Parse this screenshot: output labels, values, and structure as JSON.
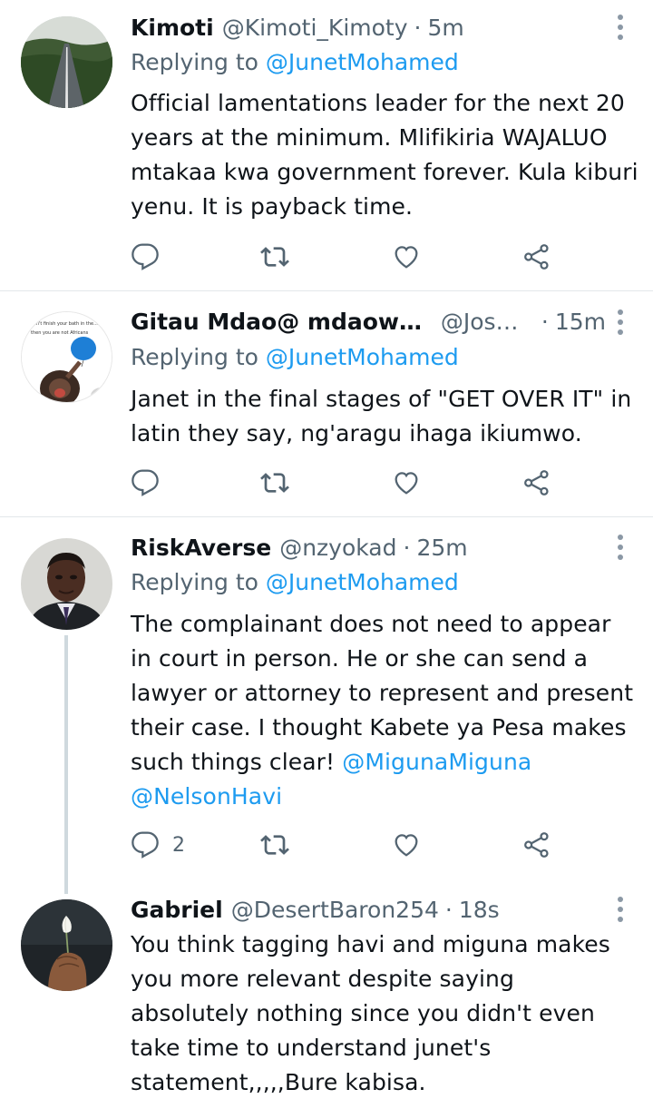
{
  "tweets": [
    {
      "name": "Kimoti",
      "handle": "@Kimoti_Kimoty",
      "sep": "·",
      "time": "5m",
      "replying_prefix": "Replying to ",
      "replying_to": "@JunetMohamed",
      "text": "Official lamentations leader for the next 20 years at the minimum. Mlifikiria WAJALUO mtakaa kwa government forever. Kula kiburi yenu. It is payback time.",
      "avatar": "road-landscape",
      "reply_count": ""
    },
    {
      "name": "Gitau Mdao@ mdaowetu",
      "handle": "@Jose...",
      "sep": "·",
      "time": "15m",
      "replying_prefix": "Replying to ",
      "replying_to": "@JunetMohamed",
      "text": "Janet in the final stages of \"GET OVER IT\" in latin they say, ng'aragu  ihaga ikiumwo.",
      "avatar": "child-with-balloon-meme",
      "reply_count": ""
    },
    {
      "name": "RiskAverse",
      "handle": "@nzyokad",
      "sep": "·",
      "time": "25m",
      "replying_prefix": "Replying to ",
      "replying_to": "@JunetMohamed",
      "text_before": "The complainant does not need to appear in court in person. He or she can send a lawyer or attorney to represent and present their case. I thought Kabete ya Pesa makes such things clear! ",
      "mention_1": "@MigunaMiguna",
      "mention_2": "@NelsonHavi",
      "avatar": "man-portrait",
      "reply_count": "2"
    },
    {
      "name": "Gabriel",
      "handle": "@DesertBaron254",
      "sep": "·",
      "time": "18s",
      "text": "You think tagging havi and miguna makes you more relevant despite saying absolutely nothing since you didn't even take time to understand junet's statement,,,,,Bure kabisa.",
      "avatar": "hands-holding-flower"
    }
  ],
  "meme_caption": "can't finish your bath in the... then you are not Africans",
  "colors": {
    "link": "#1d9bf0",
    "secondary_text": "#536471",
    "icon": "#536471",
    "divider": "#e3e7ea",
    "thread_line": "#cfd9de"
  },
  "icons": [
    "reply-icon",
    "retweet-icon",
    "like-icon",
    "share-icon",
    "more-icon"
  ]
}
